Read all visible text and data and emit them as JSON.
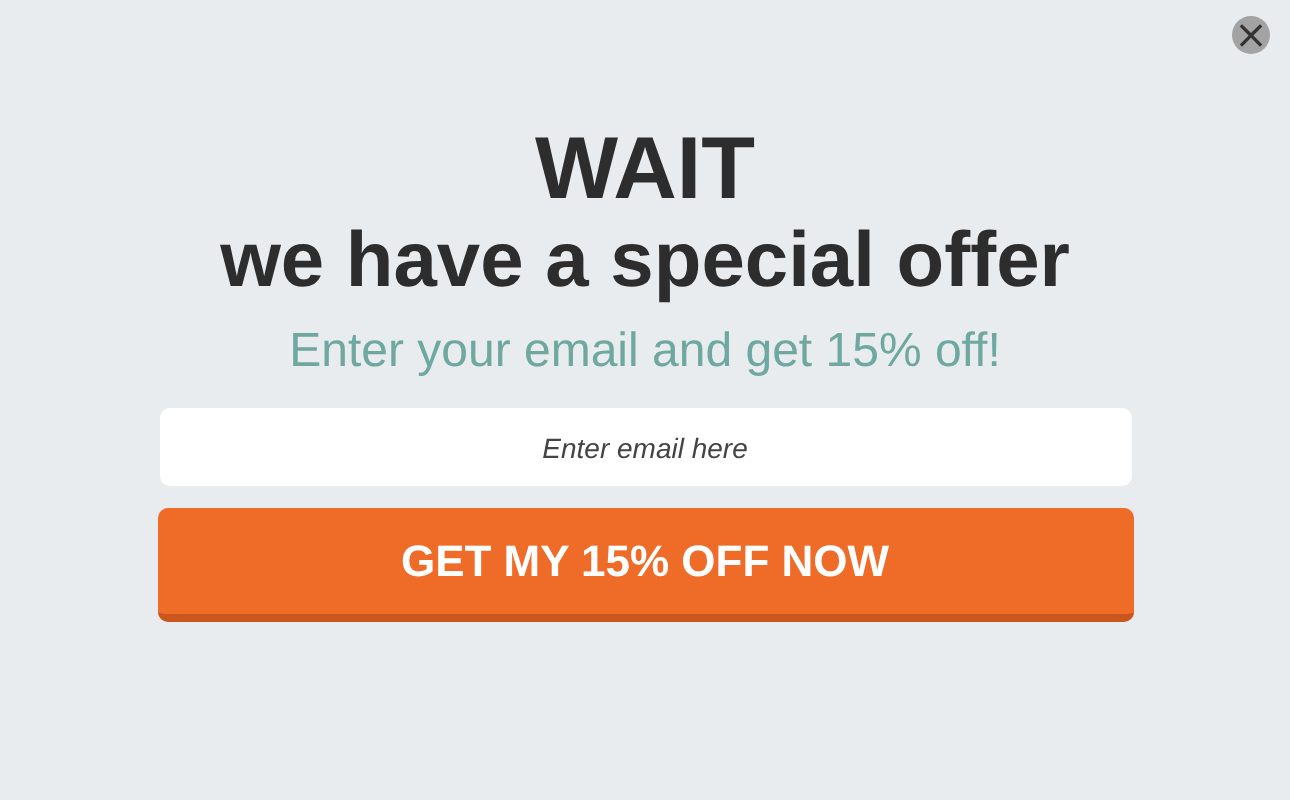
{
  "close_button": {
    "label": "×"
  },
  "headline": [
    "WAIT",
    "we have a special offer"
  ],
  "subtitle": "Enter your email and get 15% off!",
  "email_field": {
    "placeholder": "Enter email here"
  },
  "submit_button": {
    "label": "GET MY 15% OFF NOW"
  }
}
